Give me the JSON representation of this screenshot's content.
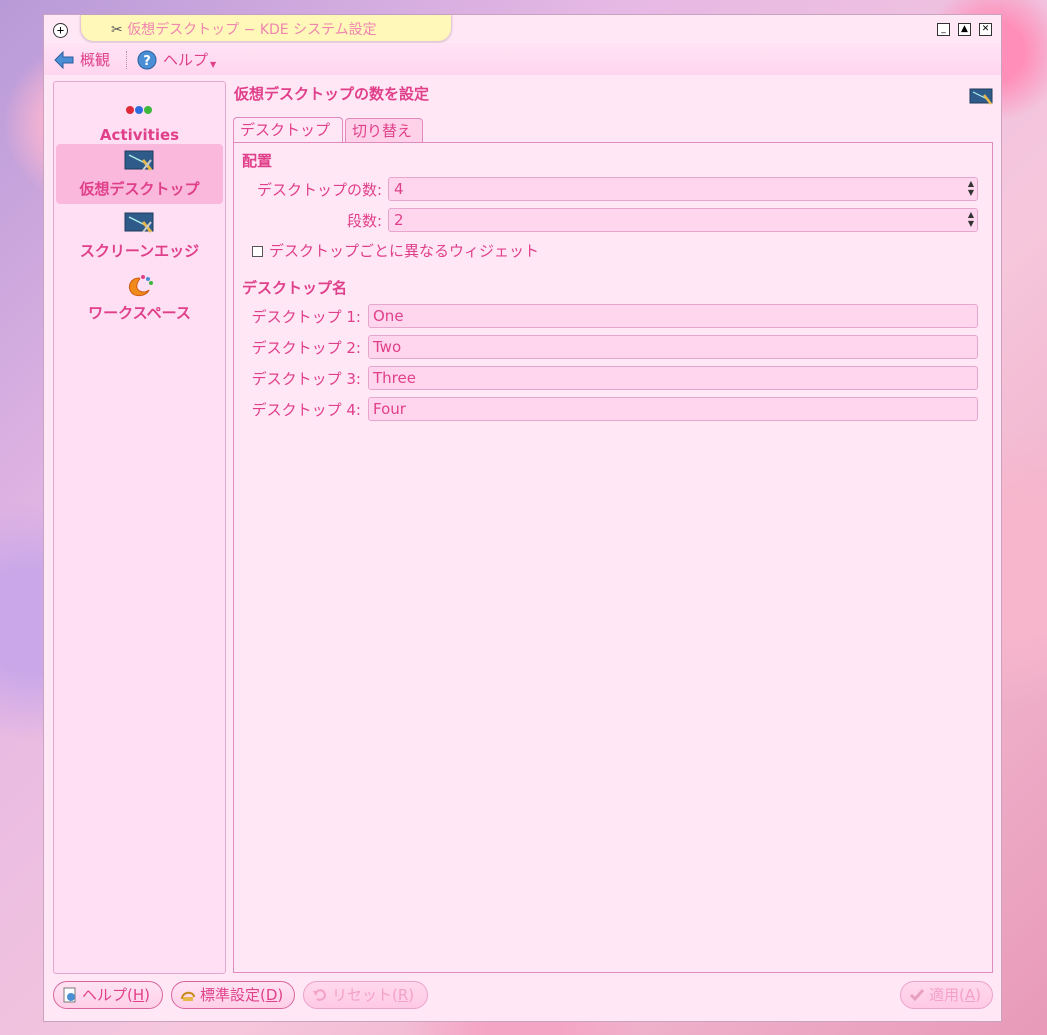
{
  "window": {
    "title": "仮想デスクトップ − KDE システム設定"
  },
  "toolbar": {
    "overview_label": "概観",
    "help_label": "ヘルプ"
  },
  "sidebar": {
    "items": [
      {
        "label": "Activities",
        "icon": "activities-icon"
      },
      {
        "label": "仮想デスクトップ",
        "icon": "virtual-desktop-icon",
        "active": true
      },
      {
        "label": "スクリーンエッジ",
        "icon": "screen-edge-icon"
      },
      {
        "label": "ワークスペース",
        "icon": "workspace-icon"
      }
    ]
  },
  "content": {
    "title": "仮想デスクトップの数を設定",
    "tabs": [
      "デスクトップ",
      "切り替え"
    ],
    "layout_section": "配置",
    "desktop_count_label": "デスクトップの数:",
    "desktop_count_value": "4",
    "rows_label": "段数:",
    "rows_value": "2",
    "per_desktop_widgets_label": "デスクトップごとに異なるウィジェット",
    "names_section": "デスクトップ名",
    "names": [
      {
        "label": "デスクトップ 1:",
        "value": "One"
      },
      {
        "label": "デスクトップ 2:",
        "value": "Two"
      },
      {
        "label": "デスクトップ 3:",
        "value": "Three"
      },
      {
        "label": "デスクトップ 4:",
        "value": "Four"
      }
    ]
  },
  "buttons": {
    "help": {
      "text": "ヘルプ(",
      "key": "H",
      "end": ")"
    },
    "defaults": {
      "text": "標準設定(",
      "key": "D",
      "end": ")"
    },
    "reset": {
      "text": "リセット(",
      "key": "R",
      "end": ")"
    },
    "apply": {
      "text": "適用(",
      "key": "A",
      "end": ")"
    }
  },
  "colors": {
    "accent": "#e0408a",
    "window_bg": "#ffe7f6",
    "title_tab_bg": "#fff8b8"
  }
}
